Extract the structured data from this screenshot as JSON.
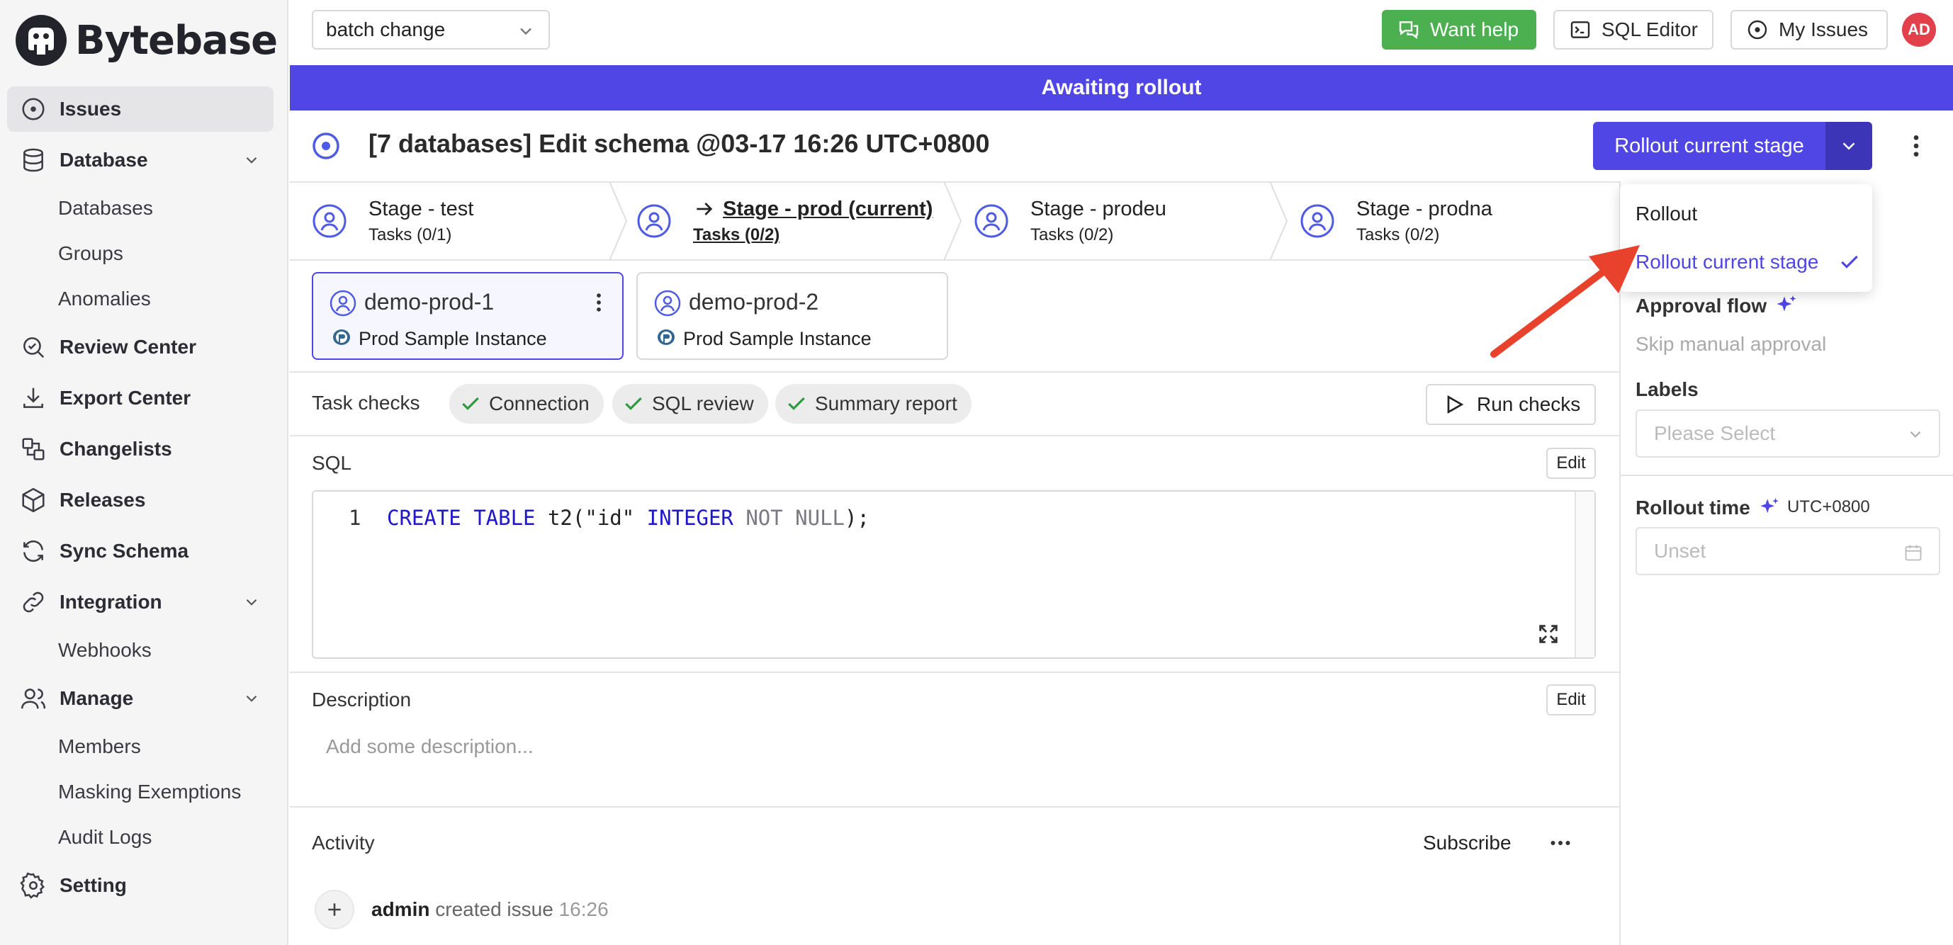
{
  "app": {
    "brand": "Bytebase"
  },
  "sidebar": {
    "items": [
      {
        "label": "Issues",
        "icon": "issues-circle-icon",
        "active": true
      },
      {
        "label": "Database",
        "icon": "database-icon"
      },
      {
        "label": "Review Center",
        "icon": "review-search-icon"
      },
      {
        "label": "Export Center",
        "icon": "download-icon"
      },
      {
        "label": "Changelists",
        "icon": "changelist-icon"
      },
      {
        "label": "Releases",
        "icon": "package-icon"
      },
      {
        "label": "Sync Schema",
        "icon": "sync-icon"
      },
      {
        "label": "Integration",
        "icon": "link-icon"
      },
      {
        "label": "Manage",
        "icon": "users-icon"
      },
      {
        "label": "Setting",
        "icon": "gear-icon"
      }
    ],
    "database_sub": [
      "Databases",
      "Groups",
      "Anomalies"
    ],
    "integration_sub": [
      "Webhooks"
    ],
    "manage_sub": [
      "Members",
      "Masking Exemptions",
      "Audit Logs"
    ]
  },
  "topbar": {
    "project": "batch change",
    "want_help": "Want help",
    "sql_editor": "SQL Editor",
    "my_issues": "My Issues",
    "avatar": "AD",
    "help_color": "#4caf50",
    "avatar_color": "#e2404b"
  },
  "banner": {
    "text": "Awaiting rollout",
    "color": "#4f46e5"
  },
  "issue": {
    "title": "[7 databases] Edit schema @03-17 16:26 UTC+0800",
    "rollout_button": "Rollout current stage"
  },
  "stages": [
    {
      "title": "Stage - test",
      "tasks": "Tasks (0/1)"
    },
    {
      "title": "Stage - prod (current)",
      "tasks": "Tasks (0/2)",
      "current": true
    },
    {
      "title": "Stage - prodeu",
      "tasks": "Tasks (0/2)"
    },
    {
      "title": "Stage - prodna",
      "tasks": "Tasks (0/2)"
    }
  ],
  "tasks": [
    {
      "name": "demo-prod-1",
      "instance": "Prod Sample Instance",
      "selected": true
    },
    {
      "name": "demo-prod-2",
      "instance": "Prod Sample Instance"
    }
  ],
  "checks": {
    "label": "Task checks",
    "items": [
      "Connection",
      "SQL review",
      "Summary report"
    ],
    "run": "Run checks"
  },
  "sql": {
    "title": "SQL",
    "edit": "Edit",
    "line": "1",
    "tokens": {
      "t1": "CREATE TABLE",
      "t2": " t2(\"id\" ",
      "t3": "INTEGER",
      "t4": " NOT NULL",
      "t5": ");"
    }
  },
  "description": {
    "title": "Description",
    "edit": "Edit",
    "placeholder": "Add some description..."
  },
  "activity": {
    "title": "Activity",
    "subscribe": "Subscribe",
    "user": "admin",
    "action": " created issue ",
    "time": "16:26"
  },
  "right_panel": {
    "approval_flow": "Approval flow",
    "approval_value": "Skip manual approval",
    "labels": "Labels",
    "labels_placeholder": "Please Select",
    "rollout_time": "Rollout time",
    "timezone": "UTC+0800",
    "rollout_placeholder": "Unset"
  },
  "dropdown": {
    "items": [
      "Rollout",
      "Rollout current stage"
    ],
    "selected": "Rollout current stage"
  },
  "annotation": {
    "arrow_color": "#e8412c"
  }
}
